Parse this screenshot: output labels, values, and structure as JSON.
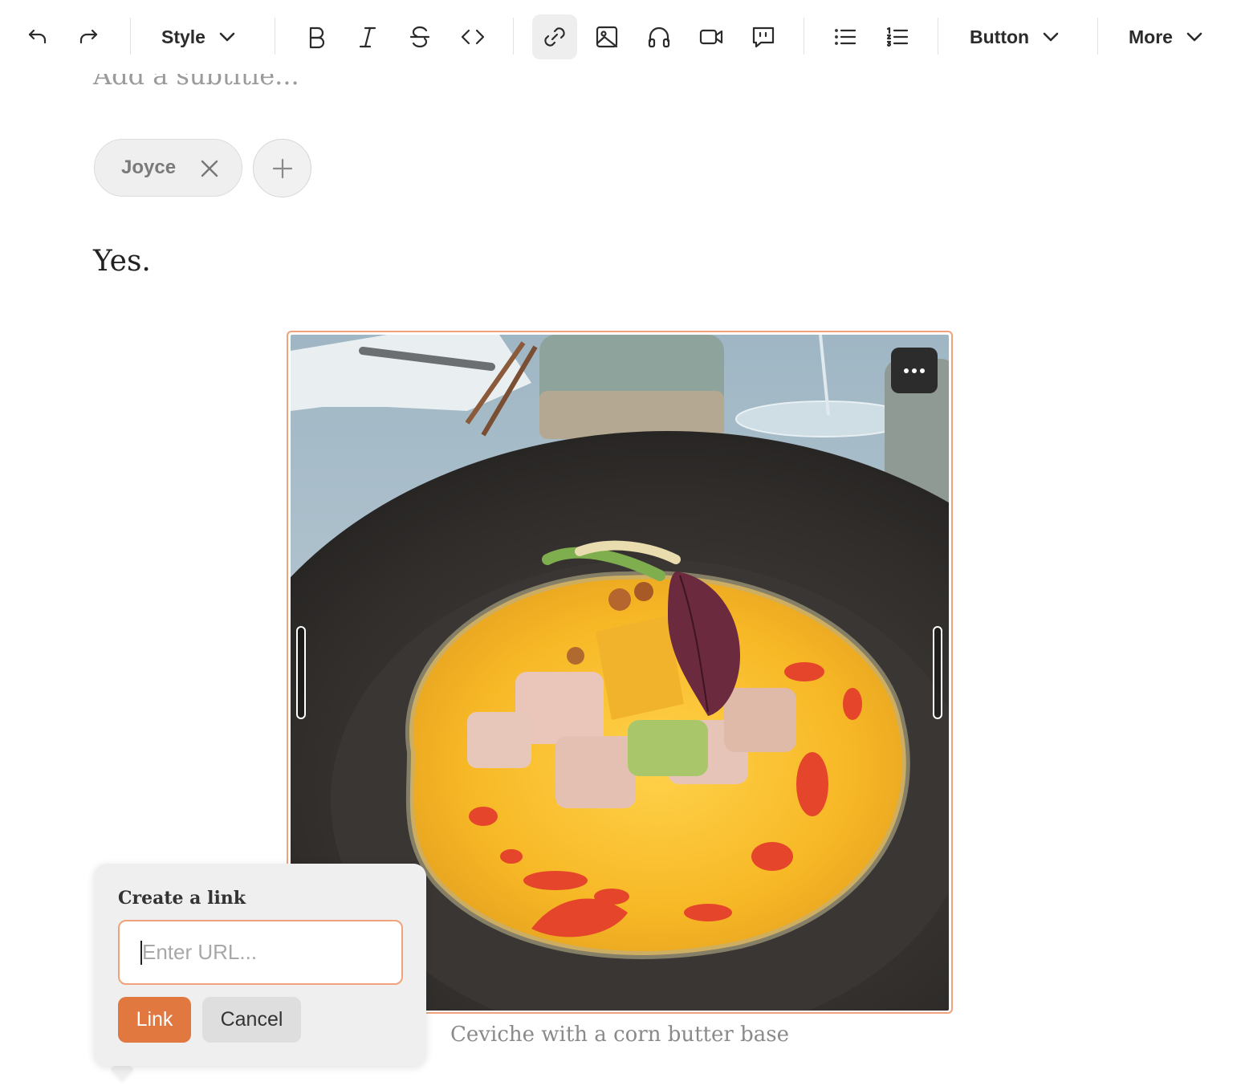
{
  "toolbar": {
    "style_label": "Style",
    "button_label": "Button",
    "more_label": "More",
    "icons": [
      "undo-icon",
      "redo-icon",
      "bold-icon",
      "italic-icon",
      "strikethrough-icon",
      "code-icon",
      "link-icon",
      "image-icon",
      "audio-icon",
      "video-icon",
      "quote-icon",
      "bullet-list-icon",
      "numbered-list-icon"
    ],
    "active_tool": "link"
  },
  "post": {
    "subtitle_placeholder": "Add a subtitle...",
    "author_chip": "Joyce",
    "body_text": "Yes.",
    "image_caption": "Ceviche with a corn butter base"
  },
  "link_popover": {
    "title": "Create a link",
    "url_placeholder": "Enter URL...",
    "url_value": "",
    "link_button": "Link",
    "cancel_button": "Cancel"
  },
  "colors": {
    "accent": "#e07840",
    "selection_border": "#f0a27a",
    "popover_bg": "#efefef"
  }
}
